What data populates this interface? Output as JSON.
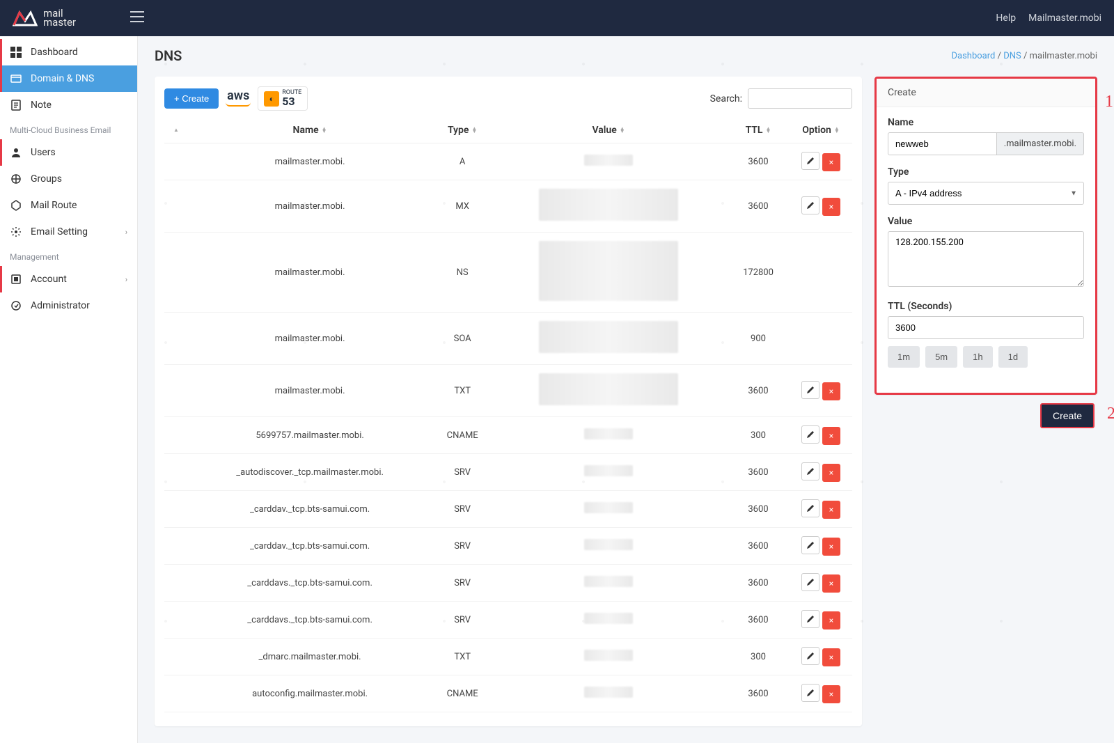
{
  "brand": {
    "name_top": "mail",
    "name_bot": "master"
  },
  "topnav": {
    "help": "Help",
    "account": "Mailmaster.mobi"
  },
  "sidebar": {
    "items": [
      {
        "label": "Dashboard",
        "icon": "dashboard"
      },
      {
        "label": "Domain & DNS",
        "icon": "domain",
        "active": true
      },
      {
        "label": "Note",
        "icon": "note"
      }
    ],
    "section_mcbe": "Multi-Cloud Business Email",
    "mcbe_items": [
      {
        "label": "Users",
        "icon": "users"
      },
      {
        "label": "Groups",
        "icon": "groups"
      },
      {
        "label": "Mail Route",
        "icon": "route"
      },
      {
        "label": "Email Setting",
        "icon": "settings",
        "chev": true
      }
    ],
    "section_mgmt": "Management",
    "mgmt_items": [
      {
        "label": "Account",
        "icon": "account",
        "chev": true
      },
      {
        "label": "Administrator",
        "icon": "admin"
      }
    ]
  },
  "page": {
    "title": "DNS",
    "crumb_dashboard": "Dashboard",
    "crumb_dns": "DNS",
    "crumb_current": "mailmaster.mobi"
  },
  "toolbar": {
    "create_btn": "+ Create",
    "aws_label": "aws",
    "r53_top": "ROUTE",
    "r53_num": "53",
    "search_label": "Search:"
  },
  "columns": {
    "name": "Name",
    "type": "Type",
    "value": "Value",
    "ttl": "TTL",
    "option": "Option"
  },
  "records": [
    {
      "name": "mailmaster.mobi.",
      "type": "A",
      "ttl": "3600",
      "blurred": "sm",
      "option": true
    },
    {
      "name": "mailmaster.mobi.",
      "type": "MX",
      "ttl": "3600",
      "blurred": "lg",
      "option": true
    },
    {
      "name": "mailmaster.mobi.",
      "type": "NS",
      "ttl": "172800",
      "blurred": "xlg",
      "option": false
    },
    {
      "name": "mailmaster.mobi.",
      "type": "SOA",
      "ttl": "900",
      "blurred": "lg",
      "option": false
    },
    {
      "name": "mailmaster.mobi.",
      "type": "TXT",
      "ttl": "3600",
      "blurred": "lg",
      "option": true
    },
    {
      "name": "5699757.mailmaster.mobi.",
      "type": "CNAME",
      "ttl": "300",
      "blurred": "sm",
      "option": true
    },
    {
      "name": "_autodiscover._tcp.mailmaster.mobi.",
      "type": "SRV",
      "ttl": "3600",
      "blurred": "sm",
      "option": true
    },
    {
      "name": "_carddav._tcp.bts-samui.com.",
      "type": "SRV",
      "ttl": "3600",
      "blurred": "sm",
      "option": true
    },
    {
      "name": "_carddav._tcp.bts-samui.com.",
      "type": "SRV",
      "ttl": "3600",
      "blurred": "sm",
      "option": true
    },
    {
      "name": "_carddavs._tcp.bts-samui.com.",
      "type": "SRV",
      "ttl": "3600",
      "blurred": "sm",
      "option": true
    },
    {
      "name": "_carddavs._tcp.bts-samui.com.",
      "type": "SRV",
      "ttl": "3600",
      "blurred": "sm",
      "option": true
    },
    {
      "name": "_dmarc.mailmaster.mobi.",
      "type": "TXT",
      "ttl": "300",
      "blurred": "sm",
      "option": true
    },
    {
      "name": "autoconfig.mailmaster.mobi.",
      "type": "CNAME",
      "ttl": "3600",
      "blurred": "sm",
      "option": true
    }
  ],
  "form": {
    "header": "Create",
    "name_label": "Name",
    "name_value": "newweb",
    "name_suffix": ".mailmaster.mobi.",
    "type_label": "Type",
    "type_value": "A - IPv4 address",
    "value_label": "Value",
    "value_text": "128.200.155.200",
    "ttl_label": "TTL (Seconds)",
    "ttl_value": "3600",
    "presets": [
      "1m",
      "5m",
      "1h",
      "1d"
    ],
    "submit": "Create"
  },
  "annotations": {
    "one": "1",
    "two": "2"
  }
}
